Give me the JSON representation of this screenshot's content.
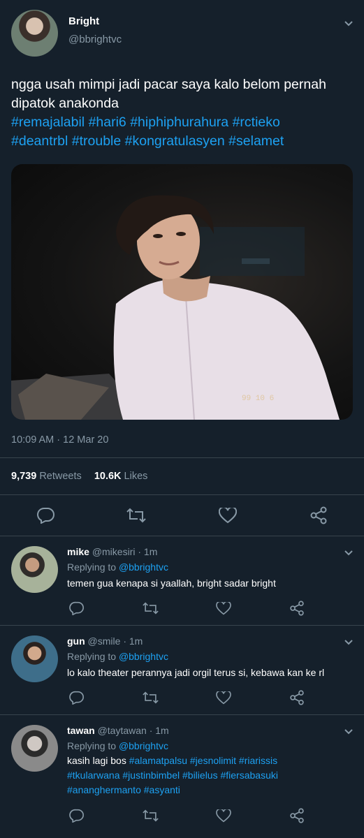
{
  "tweet": {
    "author_name": "Bright",
    "author_handle": "@bbrightvc",
    "text_plain": "ngga usah mimpi jadi pacar saya kalo belom pernah dipatok anakonda",
    "hashtags": [
      "#remajalabil",
      "#hari6",
      "#hiphiphurahura",
      "#rctieko",
      "#deantrbl",
      "#trouble",
      "#kongratulasyen",
      "#selamet"
    ],
    "timestamp": "10:09 AM · 12 Mar 20",
    "photo_stamp": "99 10 6",
    "retweets_count": "9,739",
    "retweets_label": "Retweets",
    "likes_count": "10.6K",
    "likes_label": "Likes"
  },
  "replies": [
    {
      "name": "mike",
      "handle_time": "@mikesiri · 1m",
      "replying_to_label": "Replying to",
      "replying_to_handle": "@bbrightvc",
      "text": "temen gua kenapa si yaallah, bright sadar bright",
      "hashtags": []
    },
    {
      "name": "gun",
      "handle_time": "@smile · 1m",
      "replying_to_label": "Replying to",
      "replying_to_handle": "@bbrightvc",
      "text": "lo kalo theater perannya jadi orgil terus si, kebawa kan ke rl",
      "hashtags": []
    },
    {
      "name": "tawan",
      "handle_time": "@taytawan · 1m",
      "replying_to_label": "Replying to",
      "replying_to_handle": "@bbrightvc",
      "text": "kasih lagi bos",
      "hashtags": [
        "#alamatpalsu",
        "#jesnolimit",
        "#riarissis",
        "#tkularwana",
        "#justinbimbel",
        "#bilielus",
        "#fiersabasuki",
        "#ananghermanto",
        "#asyanti"
      ]
    }
  ],
  "icons": [
    "chevron-down-icon",
    "reply-icon",
    "retweet-icon",
    "like-icon",
    "share-icon"
  ],
  "colors": {
    "background": "#15202b",
    "link": "#1da1f2",
    "muted": "#8899a6",
    "divider": "#38444d"
  }
}
